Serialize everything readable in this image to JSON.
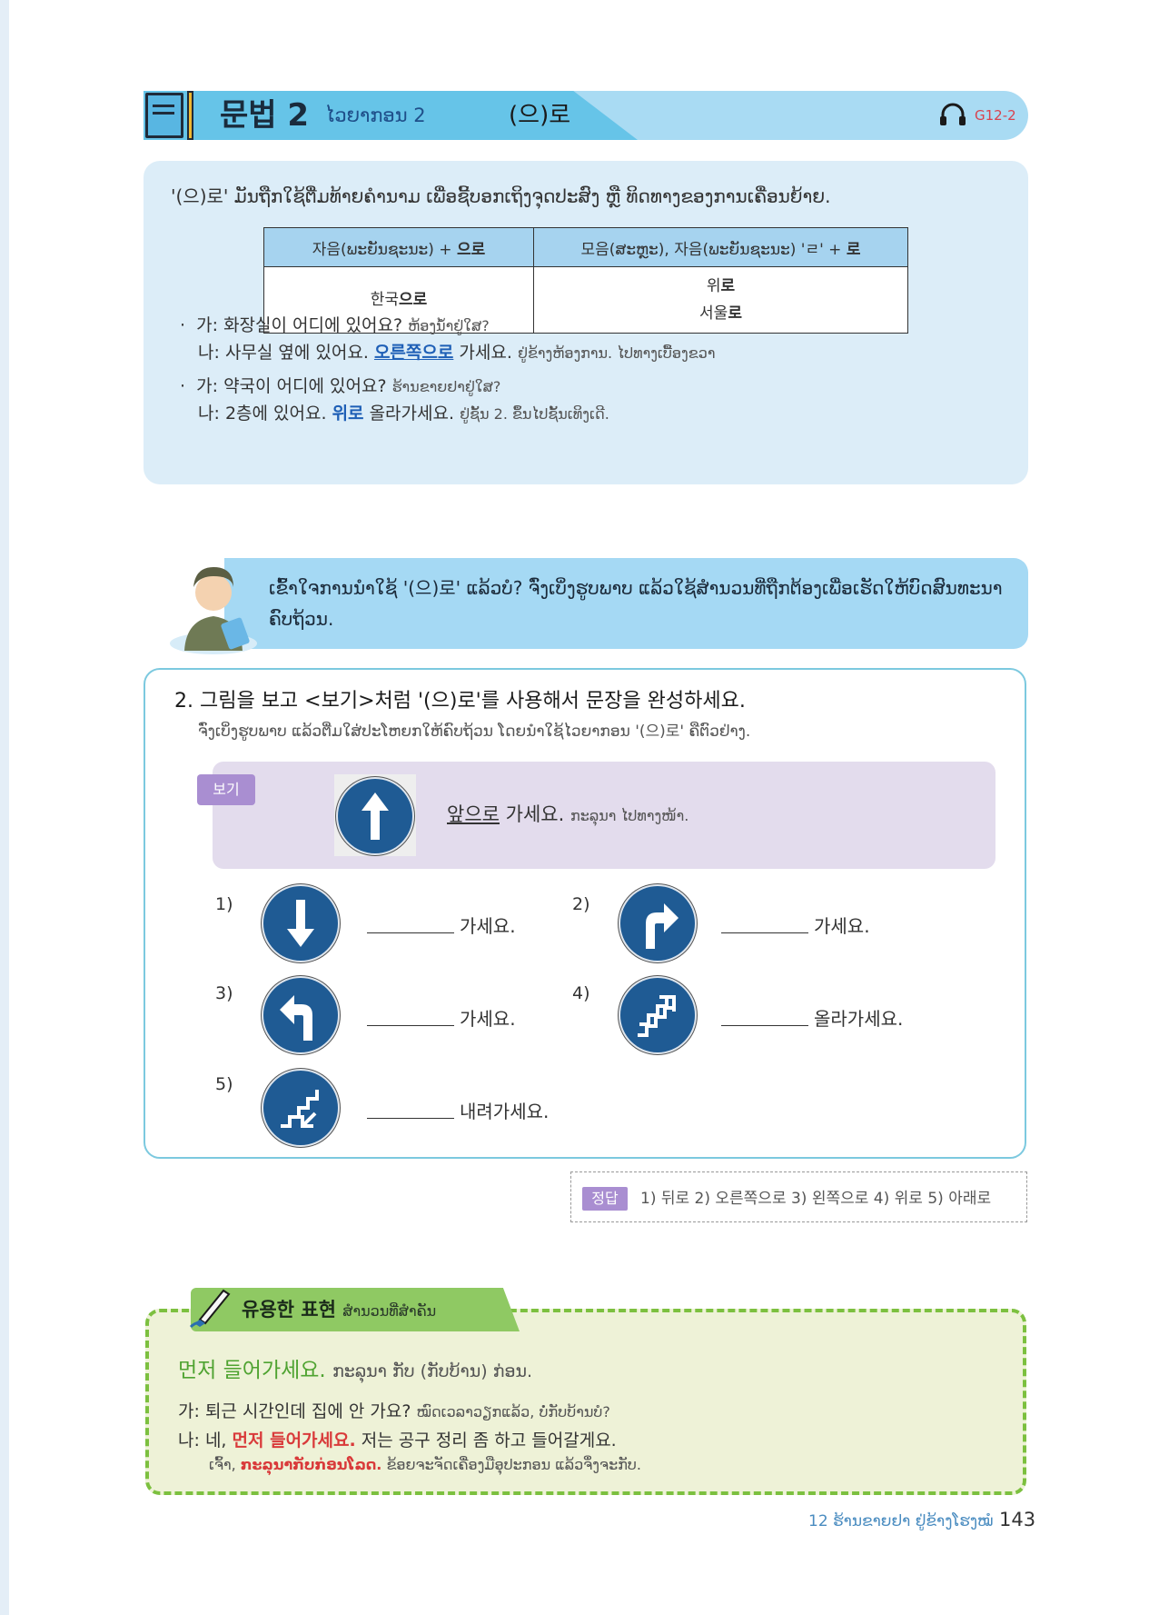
{
  "header": {
    "title": "문법 2",
    "lao_title": "ໄວຍາກອນ 2",
    "grammar_point": "(으)로",
    "audio_code": "G12-2"
  },
  "explanation": {
    "intro": "'(으)로' ມັນຖືກໃຊ້ຕື່ມທ້າຍຄຳນາມ ເພື່ອຊີ້ບອກເຖິງຈຸດປະສົງ ຫຼື ທິດທາງຂອງການເຄື່ອນຍ້າຍ.",
    "table": {
      "headers": [
        {
          "prefix": "자음(ພະຍັນຊະນະ) + ",
          "bold": "으로"
        },
        {
          "prefix": "모음(ສະຫຼະ), 자음(ພະຍັນຊະນະ) 'ㄹ' + ",
          "bold": "로"
        }
      ],
      "col1": {
        "prefix": "한국",
        "bold": "으로"
      },
      "col2": [
        {
          "prefix": "위",
          "bold": "로"
        },
        {
          "prefix": "서울",
          "bold": "로"
        }
      ]
    },
    "examples": [
      {
        "bullet": "·",
        "speaker": "가:",
        "korean": "화장실이 어디에 있어요?",
        "lao": "ຫ້ອງນ້ຳຢູ່ໃສ?"
      },
      {
        "bullet": "",
        "speaker": "나:",
        "korean_before": "사무실 옆에 있어요.",
        "highlight": "오른쪽으로",
        "korean_after": "가세요.",
        "lao": "ຢູ່ຂ້າງຫ້ອງການ. ໄປທາງເບື້ອງຂວາ"
      },
      {
        "bullet": "·",
        "speaker": "가:",
        "korean": "약국이 어디에 있어요?",
        "lao": "ຮ້ານຂາຍຢາຢູ່ໃສ?"
      },
      {
        "bullet": "",
        "speaker": "나:",
        "korean_before": "2층에 있어요.",
        "highlight": "위로",
        "korean_after": "올라가세요.",
        "lao": "ຢູ່ຊັ້ນ 2. ຂຶ້ນໄປຊັ້ນເທິງເດີ."
      }
    ]
  },
  "bubble": {
    "text": "ເຂົ້າໃຈການນຳໃຊ້ '(으)로' ແລ້ວບໍ? ຈົ່ງເບິ່ງຮູບພາບ ແລ້ວໃຊ້ສຳນວນທີ່ຖືກຕ້ອງເພື່ອເຮັດໃຫ້ບົດສົນທະນາຄົບຖ້ວນ."
  },
  "exercise": {
    "title": "2. 그림을 보고 <보기>처럼 '(으)로'를 사용해서 문장을 완성하세요.",
    "subtitle": "ຈົ່ງເບິ່ງຮູບພາບ ແລ້ວຕື່ມໃສ່ປະໂຫຍກໃຫ້ຄົບຖ້ວນ ໂດຍນຳໃຊ້ໄວຍາກອນ '(으)로' ຄືຕົວຢ່າງ.",
    "example": {
      "tag": "보기",
      "icon": "arrow-up-sign",
      "answer": "앞으로",
      "rest": "가세요.",
      "lao": "ກະລຸນາ ໄປທາງໜ້າ."
    },
    "items": [
      {
        "num": "1)",
        "icon": "arrow-down-sign",
        "text": "가세요."
      },
      {
        "num": "2)",
        "icon": "turn-right-sign",
        "text": "가세요."
      },
      {
        "num": "3)",
        "icon": "turn-left-sign",
        "text": "가세요."
      },
      {
        "num": "4)",
        "icon": "stairs-up-sign",
        "text": "올라가세요."
      },
      {
        "num": "5)",
        "icon": "stairs-down-sign",
        "text": "내려가세요."
      }
    ]
  },
  "answers": {
    "tag": "정답",
    "text": "1) 뒤로  2) 오른쪽으로  3) 왼쪽으로  4) 위로  5) 아래로"
  },
  "useful": {
    "title": "유용한 표현",
    "title_lao": "ສຳນວນທີ່ສຳຄັນ",
    "main": "먼저 들어가세요.",
    "main_lao": "ກະລຸນາ ກັບ (ກັບບ້ານ) ກ່ອນ.",
    "line1_speaker": "가:",
    "line1_korean": "퇴근 시간인데 집에 안 가요?",
    "line1_lao": "ໝົດເວລາວຽກແລ້ວ, ບໍ່ກັບບ້ານບໍ?",
    "line2_speaker": "나:",
    "line2_before": "네,",
    "line2_highlight": "먼저 들어가세요.",
    "line2_after": "저는 공구 정리 좀 하고 들어갈게요.",
    "line3_before": "ເຈົ້າ,",
    "line3_highlight": "ກະລຸນາກັບກ່ອນໂລດ.",
    "line3_after": "ຂ້ອຍຈະຈັດເຄື່ອງມືອຸປະກອນ ແລ້ວຈຶ່ງຈະກັບ."
  },
  "footer": {
    "chapter": "12 ຮ້ານຂາຍຢາ ຢູ່ຂ້າງໂຮງໝໍ",
    "page": "143"
  },
  "colors": {
    "header_bg": "#a9dbf3",
    "header_accent": "#66c4e8",
    "explanation_bg": "#dcedf8",
    "highlight_blue": "#1e5fb6",
    "sign_blue": "#1f5b94",
    "tag_purple": "#a98ed1",
    "useful_green": "#7cc03f",
    "highlight_red": "#d93a3a"
  }
}
